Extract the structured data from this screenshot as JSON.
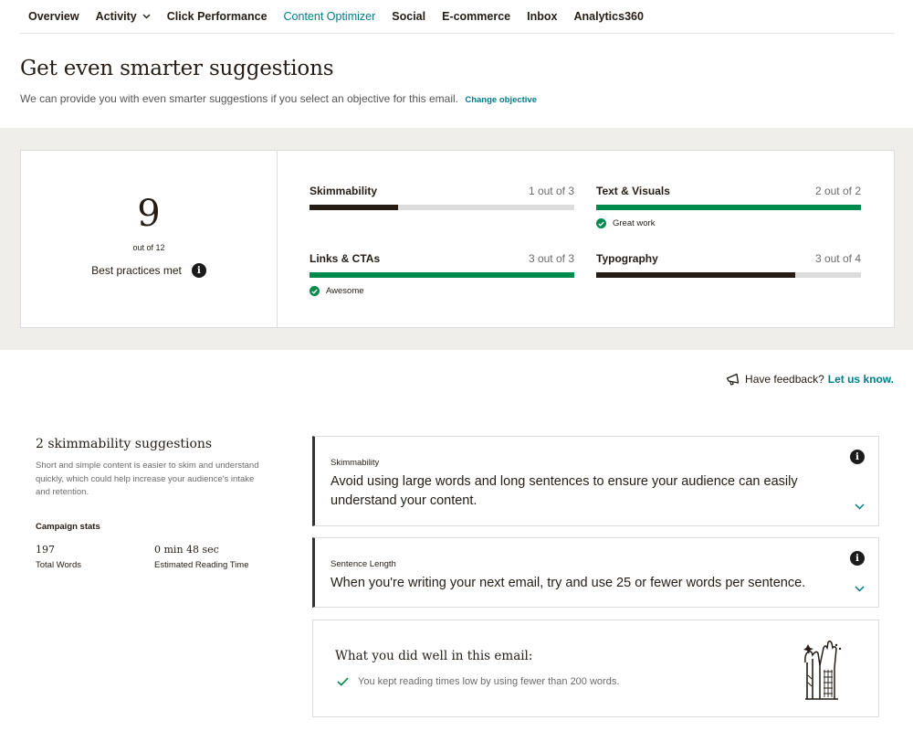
{
  "nav": {
    "items": [
      {
        "label": "Overview",
        "active": false
      },
      {
        "label": "Activity",
        "active": false,
        "dropdown": true
      },
      {
        "label": "Click Performance",
        "active": false
      },
      {
        "label": "Content Optimizer",
        "active": true
      },
      {
        "label": "Social",
        "active": false
      },
      {
        "label": "E-commerce",
        "active": false
      },
      {
        "label": "Inbox",
        "active": false
      },
      {
        "label": "Analytics360",
        "active": false
      }
    ]
  },
  "header": {
    "title": "Get even smarter suggestions",
    "subtitle": "We can provide you with even smarter suggestions if you select an objective for this email.",
    "link": "Change objective"
  },
  "score": {
    "value": "9",
    "out_of": "out of 12",
    "label": "Best practices met"
  },
  "metrics": [
    {
      "name": "Skimmability",
      "value": "1 out of 3",
      "fraction": 0.333,
      "color": "#241c15",
      "note": ""
    },
    {
      "name": "Text & Visuals",
      "value": "2 out of 2",
      "fraction": 1.0,
      "color": "#008a4e",
      "note": "Great work"
    },
    {
      "name": "Links & CTAs",
      "value": "3 out of 3",
      "fraction": 1.0,
      "color": "#008a4e",
      "note": "Awesome"
    },
    {
      "name": "Typography",
      "value": "3 out of 4",
      "fraction": 0.75,
      "color": "#241c15",
      "note": ""
    }
  ],
  "feedback": {
    "text": "Have feedback?",
    "link": "Let us know."
  },
  "suggestions_panel": {
    "title": "2 skimmability suggestions",
    "description": "Short and simple content is easier to skim and understand quickly, which could help increase your audience's intake and retention.",
    "stats_title": "Campaign stats",
    "stats": [
      {
        "value": "197",
        "label": "Total Words"
      },
      {
        "value": "0 min 48 sec",
        "label": "Estimated Reading Time"
      }
    ]
  },
  "cards": [
    {
      "title": "Skimmability",
      "body": "Avoid using large words and long sentences to ensure your audience can easily understand your content."
    },
    {
      "title": "Sentence Length",
      "body": "When you're writing your next email, try and use 25 or fewer words per sentence."
    }
  ],
  "did_well": {
    "title": "What you did well in this email:",
    "items": [
      "You kept reading times low by using fewer than 200 words."
    ]
  },
  "colors": {
    "accent": "#007c89",
    "success": "#008a4e",
    "dark": "#241c15",
    "band": "#efeeea"
  }
}
